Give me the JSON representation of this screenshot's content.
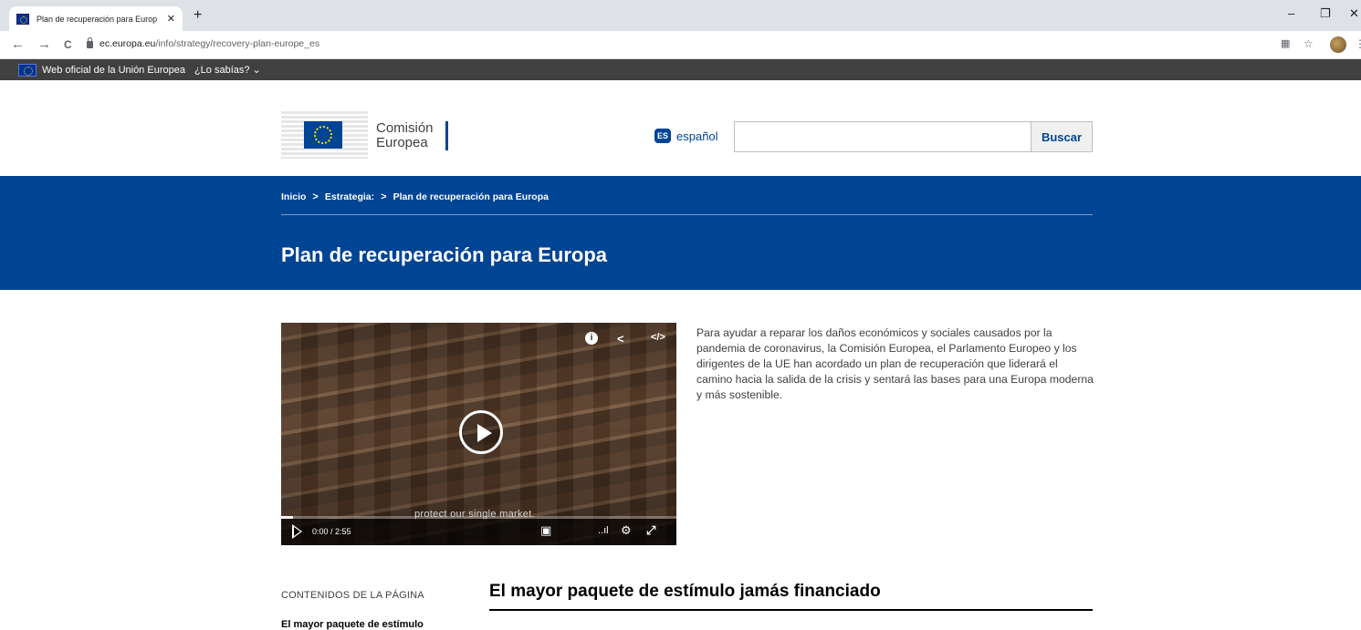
{
  "browser": {
    "tab_title": "Plan de recuperación para Europ",
    "tab_close": "✕",
    "new_tab": "+",
    "url_host": "ec.europa.eu",
    "url_path": "/info/strategy/recovery-plan-europe_es",
    "back": "←",
    "forward": "→",
    "reload": "C",
    "minimize": "–",
    "maximize": "❐",
    "close": "✕",
    "star": "☆",
    "menu": "⋮"
  },
  "eu_bar": {
    "official_text": "Web oficial de la Unión Europea",
    "did_you_know": "¿Lo sabías? ⌄"
  },
  "header": {
    "logo_line1": "Comisión",
    "logo_line2": "Europea",
    "lang_code": "ES",
    "lang_label": "español",
    "search_placeholder": "",
    "search_button": "Buscar"
  },
  "breadcrumb": {
    "items": [
      "Inicio",
      "Estrategia:",
      "Plan de recuperación para Europa"
    ],
    "separator": ">"
  },
  "page": {
    "title": "Plan de recuperación para Europa",
    "intro": "Para ayudar a reparar los daños económicos y sociales causados por la pandemia de coronavirus, la Comisión Europea, el Parlamento Europeo y los dirigentes de la UE han acordado un plan de recuperación que liderará el camino hacia la salida de la crisis y sentará las bases para una Europa moderna y más sostenible."
  },
  "video": {
    "info": "i",
    "share": "<",
    "embed": "</>",
    "subtitle": "protect our single market.",
    "time": "0:00 / 2:55",
    "progress": 0.03,
    "subtitles_icon": "▣",
    "quality_icon": "..ıl",
    "settings_icon": "⚙",
    "fullscreen_icon": "⤢"
  },
  "toc": {
    "title": "CONTENIDOS DE LA PÁGINA",
    "first_item": "El mayor paquete de estímulo"
  },
  "section": {
    "title": "El mayor paquete de estímulo jamás financiado"
  }
}
